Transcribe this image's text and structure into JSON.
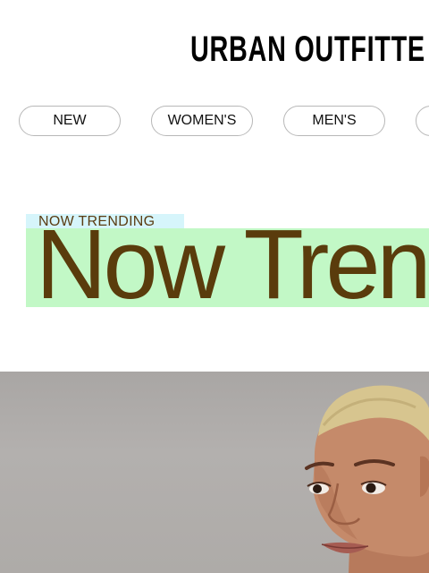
{
  "brand": {
    "logo_text": "URBAN OUTFITTE"
  },
  "nav": {
    "pills": [
      {
        "label": "NEW"
      },
      {
        "label": "WOMEN'S"
      },
      {
        "label": "MEN'S"
      },
      {
        "label": ""
      }
    ]
  },
  "trending": {
    "eyebrow": "NOW TRENDING",
    "headline": "Now Tren"
  },
  "hero": {
    "image_subject": "male-model-portrait"
  },
  "colors": {
    "eyebrow_bg": "#d6f5fb",
    "headline_bg": "#c2f8c6",
    "headline_text": "#5a3c0c",
    "hero_bg": "#aeaba8"
  }
}
